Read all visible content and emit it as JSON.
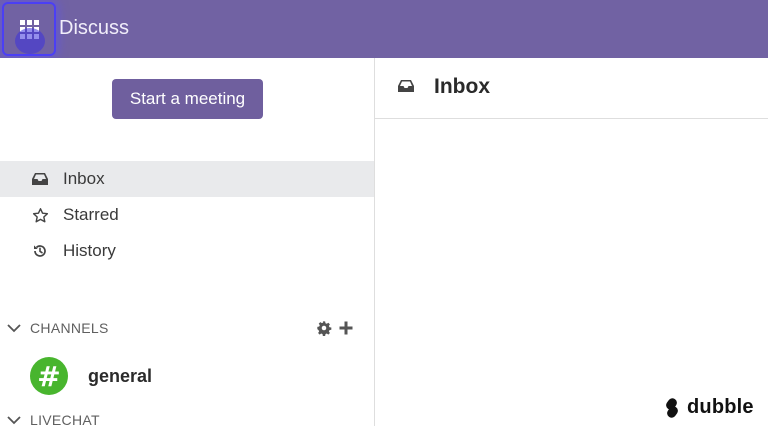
{
  "header": {
    "app_title": "Discuss",
    "apps_icon": "grid-icon"
  },
  "sidebar": {
    "start_meeting_label": "Start a meeting",
    "nav": [
      {
        "label": "Inbox",
        "icon": "inbox-icon",
        "active": true
      },
      {
        "label": "Starred",
        "icon": "star-icon",
        "active": false
      },
      {
        "label": "History",
        "icon": "history-icon",
        "active": false
      }
    ],
    "channels_section": {
      "label": "CHANNELS",
      "icons": [
        "gear-icon",
        "plus-icon"
      ]
    },
    "channels": [
      {
        "avatar_symbol": "#",
        "name": "general",
        "avatar_color": "#48b52e"
      }
    ],
    "livechat_section": {
      "label": "LIVECHAT"
    }
  },
  "main": {
    "title": "Inbox",
    "icon": "inbox-icon"
  },
  "watermark": {
    "text": "dubble"
  },
  "colors": {
    "topbar": "#7162a3",
    "primary_button": "#6f5f9e",
    "active_nav": "#e9eaec",
    "focus_ring": "#4b3ff5"
  }
}
